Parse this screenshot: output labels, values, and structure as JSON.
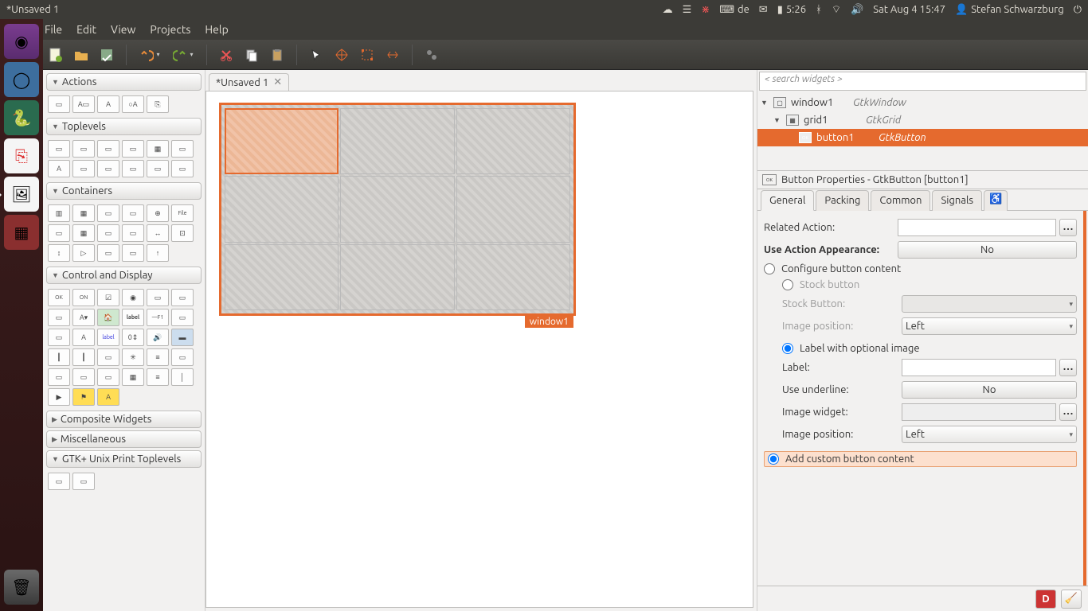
{
  "panel": {
    "title": "*Unsaved 1",
    "keyboard": "de",
    "battery_time": "5:26",
    "clock": "Sat Aug  4 15:47",
    "user": "Stefan Schwarzburg"
  },
  "menubar": [
    "File",
    "Edit",
    "View",
    "Projects",
    "Help"
  ],
  "tab": {
    "label": "*Unsaved 1"
  },
  "palette": {
    "sections": {
      "actions": "Actions",
      "toplevels": "Toplevels",
      "containers": "Containers",
      "control": "Control and Display",
      "composite": "Composite Widgets",
      "misc": "Miscellaneous",
      "print": "GTK+ Unix Print Toplevels"
    }
  },
  "canvas": {
    "window_label": "window1"
  },
  "inspector": {
    "search_placeholder": "< search widgets >",
    "tree": [
      {
        "name": "window1",
        "type": "GtkWindow",
        "depth": 0,
        "icon": "▢"
      },
      {
        "name": "grid1",
        "type": "GtkGrid",
        "depth": 1,
        "icon": "▦"
      },
      {
        "name": "button1",
        "type": "GtkButton",
        "depth": 2,
        "icon": "OK",
        "selected": true
      }
    ],
    "header": "Button Properties - GtkButton [button1]",
    "tabs": [
      "General",
      "Packing",
      "Common",
      "Signals"
    ],
    "active_tab": "General",
    "props": {
      "related_action": "Related Action:",
      "use_action_appearance": "Use Action Appearance:",
      "no": "No",
      "configure": "Configure button content",
      "stock_button_radio": "Stock button",
      "stock_button": "Stock Button:",
      "image_position": "Image position:",
      "image_position_val": "Left",
      "label_radio": "Label with optional image",
      "label": "Label:",
      "use_underline": "Use underline:",
      "image_widget": "Image widget:",
      "add_custom": "Add custom button content"
    }
  }
}
